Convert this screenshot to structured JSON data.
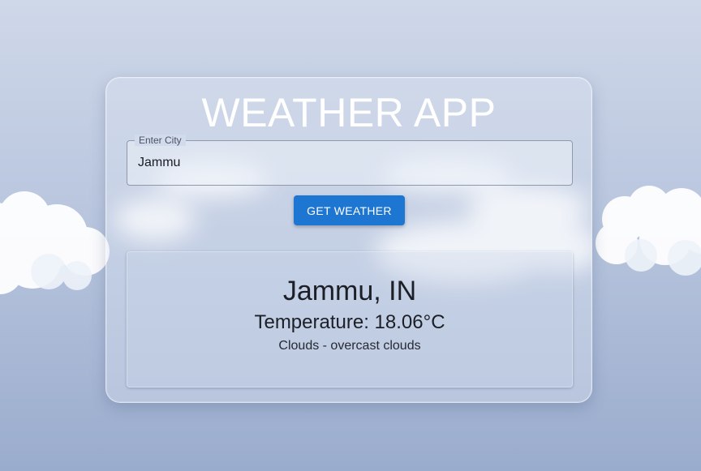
{
  "app": {
    "title": "WEATHER APP"
  },
  "search": {
    "label": "Enter City",
    "value": "Jammu",
    "button_label": "GET WEATHER"
  },
  "result": {
    "city": "Jammu, IN",
    "temperature": "Temperature: 18.06°C",
    "description": "Clouds - overcast clouds"
  },
  "colors": {
    "accent": "#1d76d2",
    "title_text": "#ffffff"
  }
}
